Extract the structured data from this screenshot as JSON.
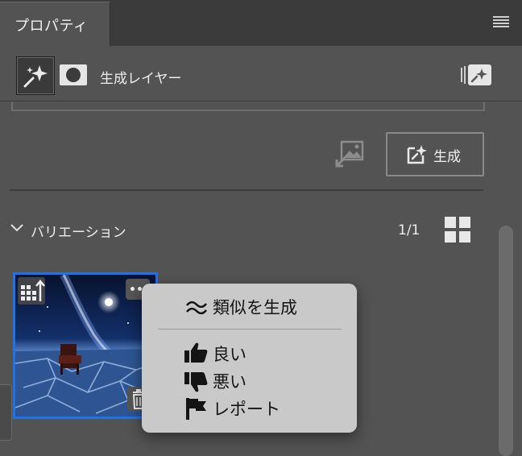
{
  "panel": {
    "tab_label": "プロパティ",
    "layer_name": "生成レイヤー"
  },
  "actions": {
    "generate_label": "生成"
  },
  "variations": {
    "title": "バリエーション",
    "count": "1/1"
  },
  "context_menu": {
    "items": [
      {
        "label": "類似を生成",
        "icon": "approx-icon"
      },
      {
        "label": "良い",
        "icon": "thumbs-up-icon"
      },
      {
        "label": "悪い",
        "icon": "thumbs-down-icon"
      },
      {
        "label": "レポート",
        "icon": "flag-icon"
      }
    ]
  },
  "colors": {
    "panel_bg": "#535353",
    "tab_bar_bg": "#3b3b3b",
    "selection_accent": "#1e73e8",
    "menu_bg": "#c9c9c9"
  }
}
